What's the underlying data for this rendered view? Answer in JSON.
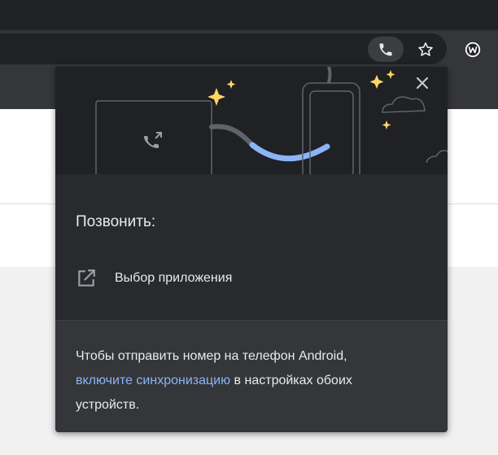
{
  "dialog": {
    "title": "Позвонить:",
    "app_option": "Выбор приложения",
    "footer_prefix": "Чтобы отправить номер на телефон Android,",
    "footer_link": "включите синхронизацию",
    "footer_suffix": " в настройках обоих устройств."
  },
  "icons": {
    "toolbar": [
      "phone-icon",
      "star-icon",
      "wappalyzer-icon"
    ],
    "dialog": [
      "close-icon",
      "open-external-icon",
      "call-forward-icon"
    ]
  },
  "colors": {
    "bubble_bg": "#292a2d",
    "footer_bg": "#35363a",
    "link": "#8ab4f8",
    "text": "#e8eaed",
    "sparkle": "#fdd663",
    "cable_accent": "#8ab4f8"
  }
}
